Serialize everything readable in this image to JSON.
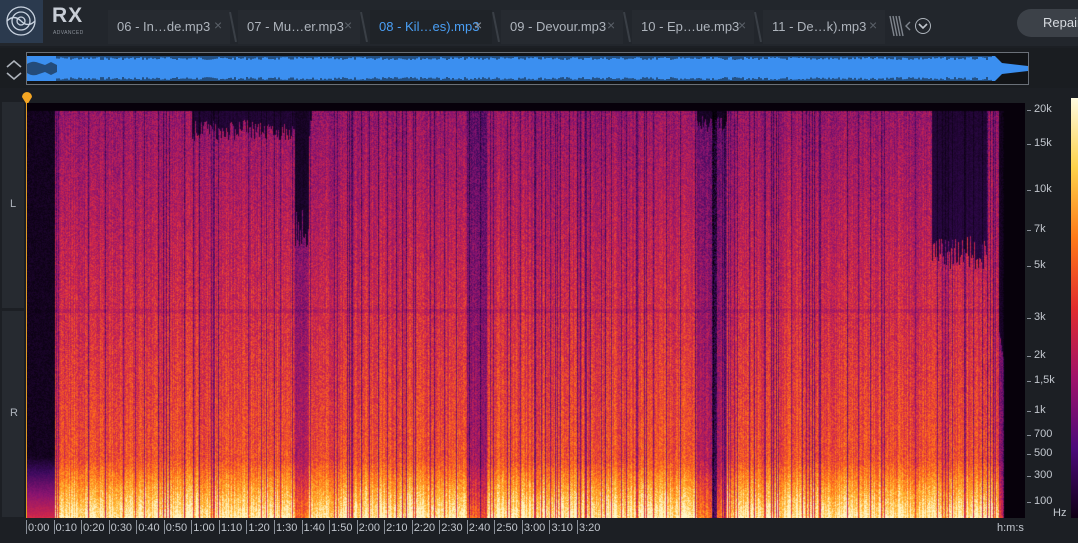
{
  "app": {
    "name": "RX",
    "edition": "ADVANCED"
  },
  "tabs": [
    {
      "label": "06 - In…de.mp3",
      "active": false
    },
    {
      "label": "07 - Mu…er.mp3",
      "active": false
    },
    {
      "label": "08 - Kil…es).mp3",
      "active": true
    },
    {
      "label": "09 - Devour.mp3",
      "active": false
    },
    {
      "label": "10 - Ep…ue.mp3",
      "active": false
    },
    {
      "label": "11 - De…k).mp3",
      "active": false
    }
  ],
  "tab_close_glyph": "×",
  "repair_button": "Repair",
  "channels": {
    "left": "L",
    "right": "R"
  },
  "frequency_axis": {
    "unit": "Hz",
    "ticks": [
      "20k",
      "15k",
      "10k",
      "7k",
      "5k",
      "3k",
      "2k",
      "1,5k",
      "1k",
      "700",
      "500",
      "300",
      "100"
    ]
  },
  "time_axis": {
    "unit": "h:m:s",
    "ticks": [
      "0:00",
      "0:10",
      "0:20",
      "0:30",
      "0:40",
      "0:50",
      "1:00",
      "1:10",
      "1:20",
      "1:30",
      "1:40",
      "1:50",
      "2:00",
      "2:10",
      "2:20",
      "2:30",
      "2:40",
      "2:50",
      "3:00",
      "3:10",
      "3:20"
    ]
  },
  "colors": {
    "accent_active_tab": "#4a9ff5",
    "waveform": "#3b8ff0",
    "playhead": "#f5a623",
    "spectrogram_palette": [
      "#000000",
      "#3b0a5e",
      "#8a1470",
      "#d2274a",
      "#ff6a1a",
      "#ffb62e",
      "#fff6c8"
    ]
  },
  "icons": {
    "logo": "rx-logo-icon",
    "tab_overflow": "tab-overflow-icon",
    "tabs_dropdown": "chevron-down-icon",
    "zoom": "zoom-stepper-icon",
    "playhead": "playhead-marker-icon"
  }
}
